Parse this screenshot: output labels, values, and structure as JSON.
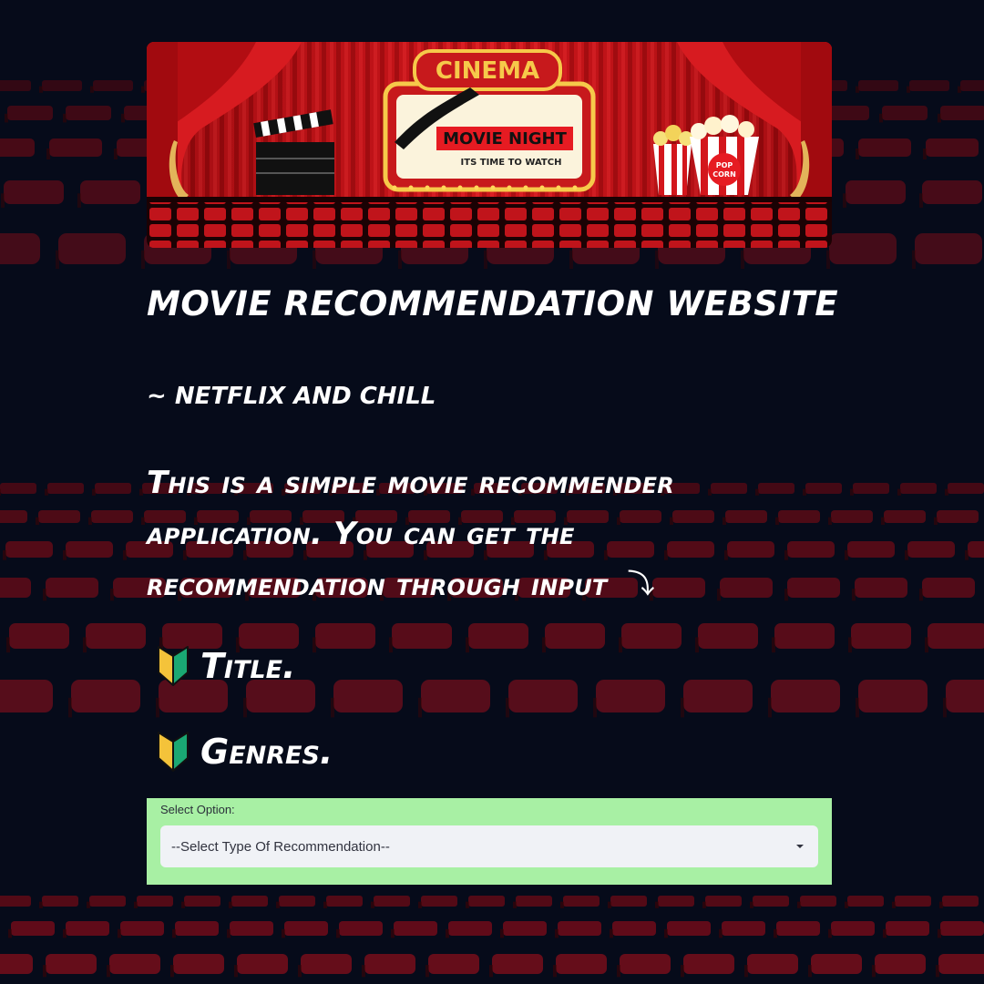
{
  "banner": {
    "marquee": "CINEMA",
    "headline": "MOVIE NIGHT",
    "tagline": "ITS TIME TO WATCH",
    "popcorn_label_line1": "POP",
    "popcorn_label_line2": "CORN"
  },
  "heading": {
    "title": "MOVIE RECOMMENDATION WEBSITE",
    "subtitle": "~ NETFLIX AND CHILL"
  },
  "intro": {
    "text": "This is a simple movie recommender application. You can get the recommendation through input",
    "arrow_icon": "return-arrow-icon"
  },
  "options": [
    {
      "label": "Title.",
      "icon": "beginner-mark-icon"
    },
    {
      "label": "Genres.",
      "icon": "beginner-mark-icon"
    }
  ],
  "select": {
    "label": "Select Option:",
    "value": "--Select Type Of Recommendation--",
    "icon": "chevron-down-icon"
  },
  "colors": {
    "background": "#060b1a",
    "select_panel": "#a8f0a4",
    "select_control": "#f0f2f6",
    "seat_red": "#b3121a"
  }
}
